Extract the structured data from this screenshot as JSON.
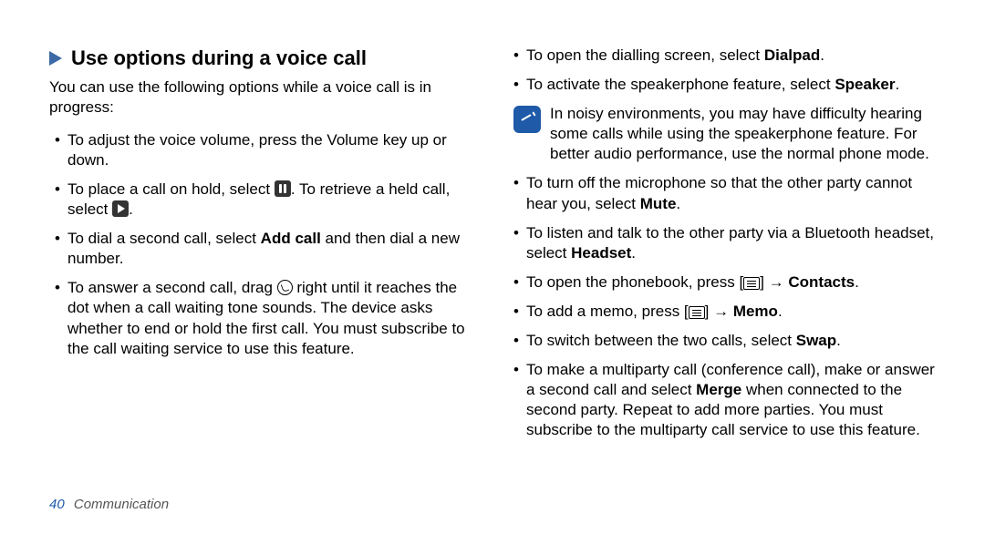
{
  "heading": "Use options during a voice call",
  "intro": "You can use the following options while a voice call is in progress:",
  "left": {
    "item1": "To adjust the voice volume, press the Volume key up or down.",
    "item2a": "To place a call on hold, select ",
    "item2b": ". To retrieve a held call, select ",
    "item2c": ".",
    "item3a": "To dial a second call, select ",
    "item3_bold": "Add call",
    "item3b": " and then dial a new number.",
    "item4a": "To answer a second call, drag ",
    "item4b": " right until it reaches the dot when a call waiting tone sounds. The device asks whether to end or hold the first call. You must subscribe to the call waiting service to use this feature."
  },
  "right": {
    "item1a": "To open the dialling screen, select ",
    "item1_bold": "Dialpad",
    "item1b": ".",
    "item2a": "To activate the speakerphone feature, select ",
    "item2_bold": "Speaker",
    "item2b": ".",
    "note": "In noisy environments, you may have difficulty hearing some calls while using the speakerphone feature. For better audio performance, use the normal phone mode.",
    "item3a": "To turn off the microphone so that the other party cannot hear you, select ",
    "item3_bold": "Mute",
    "item3b": ".",
    "item4a": "To listen and talk to the other party via a Bluetooth headset, select ",
    "item4_bold": "Headset",
    "item4b": ".",
    "item5a": "To open the phonebook, press [",
    "item5b": "] → ",
    "item5_bold": "Contacts",
    "item5c": ".",
    "item6a": "To add a memo, press [",
    "item6b": "] → ",
    "item6_bold": "Memo",
    "item6c": ".",
    "item7a": "To switch between the two calls, select ",
    "item7_bold": "Swap",
    "item7b": ".",
    "item8a": "To make a multiparty call (conference call), make or answer a second call and select ",
    "item8_bold": "Merge",
    "item8b": " when connected to the second party. Repeat to add more parties. You must subscribe to the multiparty call service to use this feature."
  },
  "footer": {
    "page": "40",
    "section": "Communication"
  }
}
